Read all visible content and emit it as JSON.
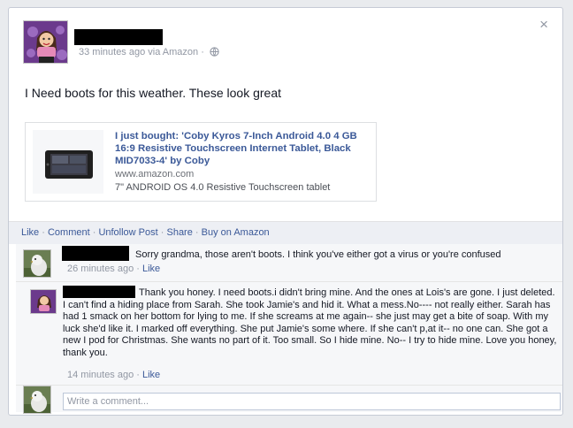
{
  "post": {
    "time_via": "33 minutes ago via Amazon",
    "separator": "·",
    "status": "I Need boots for this weather. These look great",
    "close_glyph": "×"
  },
  "share": {
    "title": "I just bought: 'Coby Kyros 7-Inch Android 4.0 4 GB 16:9 Resistive Touchscreen Internet Tablet, Black MID7033-4' by Coby",
    "domain": "www.amazon.com",
    "caption": "7\" ANDROID OS 4.0 Resistive Touchscreen tablet"
  },
  "actions": {
    "like": "Like",
    "comment": "Comment",
    "unfollow": "Unfollow Post",
    "share": "Share",
    "buy": "Buy on Amazon",
    "sep": " · "
  },
  "comments": [
    {
      "text": "Sorry grandma, those aren't boots. I think you've either got a virus or you're confused",
      "time": "26 minutes ago",
      "like": "Like"
    },
    {
      "text": "Thank you honey. I need boots.i didn't bring mine. And the ones at Lois's are gone. I just deleted. I can't find a hiding place from Sarah. She took Jamie's and hid it. What a mess.No---- not really either. Sarah has had 1 smack on her bottom for lying to me. If she screams at me again-- she just may get a bite of soap. With my luck she'd like it. I marked off everything. She put Jamie's some where. If she can't p,at it-- no one can. She got a new I pod for Christmas. She wants no part of it. Too small. So I hide mine. No-- I try to hide mine. Love you honey, thank you.",
      "time": "14 minutes ago",
      "like": "Like"
    }
  ],
  "composer": {
    "placeholder": "Write a comment..."
  },
  "colors": {
    "link": "#3b5998",
    "meta": "#9197a3",
    "ufi_bg": "#f6f7f9"
  }
}
